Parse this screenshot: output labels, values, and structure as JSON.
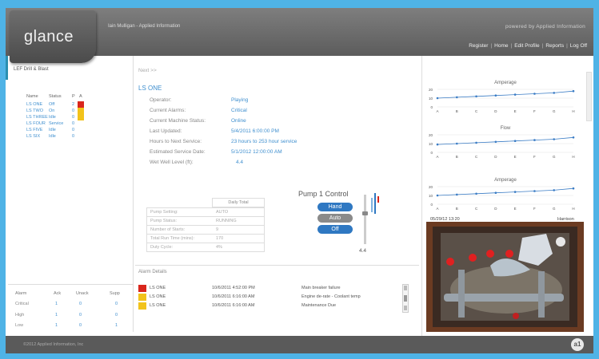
{
  "header": {
    "logo": "glance",
    "user": "Iain Mulligan - Applied Information",
    "powered": "powered by Applied Information",
    "nav": [
      "Register",
      "Home",
      "Edit Profile",
      "Reports",
      "Log Off"
    ]
  },
  "left": {
    "title": "LEF Drill & Blast",
    "columns": [
      "Name",
      "Status",
      "P",
      "A"
    ],
    "stations": [
      {
        "name": "LS ONE",
        "status": "Off",
        "p": "2"
      },
      {
        "name": "LS TWO",
        "status": "On",
        "p": "0"
      },
      {
        "name": "LS THREE",
        "status": "Idle",
        "p": "0"
      },
      {
        "name": "LS FOUR",
        "status": "Service",
        "p": "0"
      },
      {
        "name": "LS FIVE",
        "status": "Idle",
        "p": "0"
      },
      {
        "name": "LS SIX",
        "status": "Idle",
        "p": "0"
      }
    ],
    "alarm_columns": [
      "Alarm",
      "Ack",
      "Unack",
      "Supp"
    ],
    "alarms": [
      {
        "level": "Critical",
        "ack": "1",
        "unack": "0",
        "supp": "0"
      },
      {
        "level": "High",
        "ack": "1",
        "unack": "0",
        "supp": "0"
      },
      {
        "level": "Low",
        "ack": "1",
        "unack": "0",
        "supp": "1"
      }
    ]
  },
  "main": {
    "next": "Next >>",
    "station": "LS ONE",
    "fields": [
      {
        "label": "Operator:",
        "value": "Playing"
      },
      {
        "label": "Current Alarms:",
        "value": "Critical"
      },
      {
        "label": "Current Machine Status:",
        "value": "Online"
      },
      {
        "label": "Last Updated:",
        "value": "5/4/2011 6:00:00 PM"
      },
      {
        "label": "Hours to Next Service:",
        "value": "23 hours to 253 hour service"
      },
      {
        "label": "Estimated Service Date:",
        "value": "5/1/2012 12:00:00 AM"
      },
      {
        "label": "Wet Well Level (ft):",
        "value": "4.4"
      }
    ],
    "daily_header": "Daily Total",
    "daily_rows": [
      {
        "label": "Pump Setting:",
        "value": "AUTO"
      },
      {
        "label": "Pump Status:",
        "value": "RUNNING"
      },
      {
        "label": "Number of Starts:",
        "value": "9"
      },
      {
        "label": "Total Run Time (mins):",
        "value": "170"
      },
      {
        "label": "Duty Cycle:",
        "value": "4%"
      }
    ],
    "pump_title": "Pump 1 Control",
    "buttons": [
      "Hand",
      "Auto",
      "Off"
    ],
    "level_value": "4.4"
  },
  "alarm_details": {
    "title": "Alarm Details",
    "rows": [
      {
        "station": "LS ONE",
        "time": "10/6/2011 4:52:00 PM",
        "message": "Main breaker failure",
        "color": "#d9261c"
      },
      {
        "station": "LS ONE",
        "time": "10/6/2011 6:16:00 AM",
        "message": "Engine de-rate - Coolant temp",
        "color": "#f2c31b"
      },
      {
        "station": "LS ONE",
        "time": "10/6/2011 6:16:00 AM",
        "message": "Maintenance Due",
        "color": "#f2c31b"
      }
    ]
  },
  "charts": {
    "titles": [
      "Amperage",
      "Flow",
      "Amperage"
    ],
    "x_labels": [
      "A",
      "B",
      "C",
      "D",
      "E",
      "F",
      "G",
      "H"
    ],
    "y_labels": [
      "20",
      "10",
      "0"
    ],
    "camera_time": "05/29/12 13:20",
    "camera_name": "Harrison"
  },
  "chart_data": [
    {
      "type": "line",
      "title": "Amperage",
      "categories": [
        "A",
        "B",
        "C",
        "D",
        "E",
        "F",
        "G",
        "H"
      ],
      "values": [
        10,
        11,
        12,
        13,
        14,
        15,
        16,
        18
      ],
      "ylim": [
        0,
        20
      ]
    },
    {
      "type": "line",
      "title": "Flow",
      "categories": [
        "A",
        "B",
        "C",
        "D",
        "E",
        "F",
        "G",
        "H"
      ],
      "values": [
        9,
        10,
        11,
        12,
        13,
        14,
        15,
        17
      ],
      "ylim": [
        0,
        20
      ]
    },
    {
      "type": "line",
      "title": "Amperage",
      "categories": [
        "A",
        "B",
        "C",
        "D",
        "E",
        "F",
        "G",
        "H"
      ],
      "values": [
        10,
        11,
        12,
        13,
        14,
        15,
        16,
        18
      ],
      "ylim": [
        0,
        20
      ]
    }
  ],
  "footer": {
    "copy": "©2012 Applied Information, Inc",
    "badge": "a1"
  }
}
